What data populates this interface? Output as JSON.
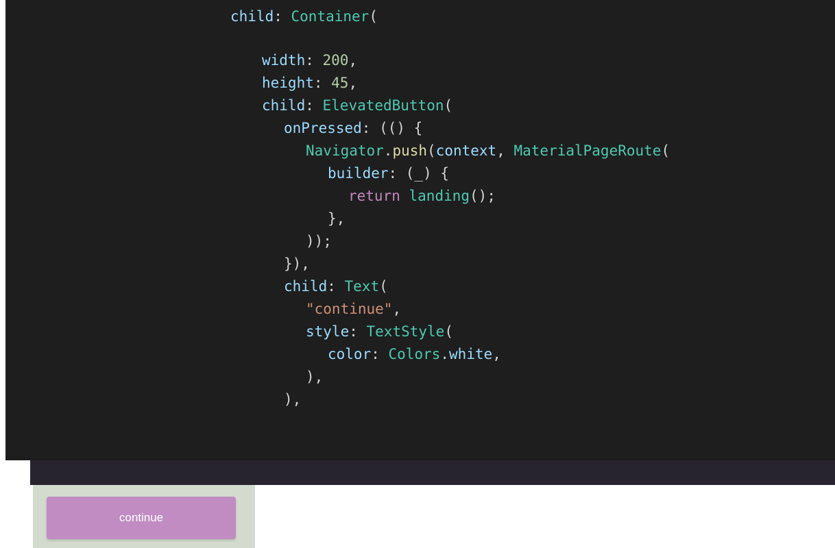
{
  "colors": {
    "code_background": "#1e1e1e",
    "strip_background": "#28242f",
    "preview_background": "#d3dbcf",
    "button_background": "#c08cc2",
    "button_text": "#ffffff",
    "token_property": "#9cdcfe",
    "token_class": "#4ec9b0",
    "token_number": "#b5cea8",
    "token_string": "#ce9178",
    "token_keyword": "#c586c0",
    "token_method": "#dcdcaa",
    "token_punct": "#d4d4d4"
  },
  "code": {
    "lines": [
      {
        "tokens": [
          {
            "t": "child",
            "k": "property"
          },
          {
            "t": ": ",
            "k": "punct"
          },
          {
            "t": "Container",
            "k": "class"
          },
          {
            "t": "(",
            "k": "punct"
          }
        ]
      },
      {
        "tokens": [
          {
            "t": "width",
            "k": "property"
          },
          {
            "t": ": ",
            "k": "punct"
          },
          {
            "t": "200",
            "k": "number"
          },
          {
            "t": ",",
            "k": "punct"
          }
        ]
      },
      {
        "tokens": [
          {
            "t": "height",
            "k": "property"
          },
          {
            "t": ": ",
            "k": "punct"
          },
          {
            "t": "45",
            "k": "number"
          },
          {
            "t": ",",
            "k": "punct"
          }
        ]
      },
      {
        "tokens": [
          {
            "t": "child",
            "k": "property"
          },
          {
            "t": ": ",
            "k": "punct"
          },
          {
            "t": "ElevatedButton",
            "k": "class"
          },
          {
            "t": "(",
            "k": "punct"
          }
        ]
      },
      {
        "tokens": [
          {
            "t": "onPressed",
            "k": "property"
          },
          {
            "t": ": (() {",
            "k": "punct"
          }
        ]
      },
      {
        "tokens": [
          {
            "t": "Navigator",
            "k": "class"
          },
          {
            "t": ".",
            "k": "punct"
          },
          {
            "t": "push",
            "k": "method"
          },
          {
            "t": "(",
            "k": "punct"
          },
          {
            "t": "context",
            "k": "property"
          },
          {
            "t": ", ",
            "k": "punct"
          },
          {
            "t": "MaterialPageRoute",
            "k": "class"
          },
          {
            "t": "(",
            "k": "punct"
          }
        ]
      },
      {
        "tokens": [
          {
            "t": "builder",
            "k": "property"
          },
          {
            "t": ": (_) {",
            "k": "punct"
          }
        ]
      },
      {
        "tokens": [
          {
            "t": "return",
            "k": "keyword"
          },
          {
            "t": " ",
            "k": "punct"
          },
          {
            "t": "landing",
            "k": "class"
          },
          {
            "t": "();",
            "k": "punct"
          }
        ]
      },
      {
        "tokens": [
          {
            "t": "},",
            "k": "punct"
          }
        ]
      },
      {
        "tokens": [
          {
            "t": "));",
            "k": "punct"
          }
        ]
      },
      {
        "tokens": [
          {
            "t": "}),",
            "k": "punct"
          }
        ]
      },
      {
        "tokens": [
          {
            "t": "child",
            "k": "property"
          },
          {
            "t": ": ",
            "k": "punct"
          },
          {
            "t": "Text",
            "k": "class"
          },
          {
            "t": "(",
            "k": "punct"
          }
        ]
      },
      {
        "tokens": [
          {
            "t": "\"continue\"",
            "k": "string"
          },
          {
            "t": ",",
            "k": "punct"
          }
        ]
      },
      {
        "tokens": [
          {
            "t": "style",
            "k": "property"
          },
          {
            "t": ": ",
            "k": "punct"
          },
          {
            "t": "TextStyle",
            "k": "class"
          },
          {
            "t": "(",
            "k": "punct"
          }
        ]
      },
      {
        "tokens": [
          {
            "t": "color",
            "k": "property"
          },
          {
            "t": ": ",
            "k": "punct"
          },
          {
            "t": "Colors",
            "k": "class"
          },
          {
            "t": ".",
            "k": "punct"
          },
          {
            "t": "white",
            "k": "property"
          },
          {
            "t": ",",
            "k": "punct"
          }
        ]
      },
      {
        "tokens": [
          {
            "t": "),",
            "k": "punct"
          }
        ]
      },
      {
        "tokens": [
          {
            "t": "),",
            "k": "punct"
          }
        ]
      }
    ]
  },
  "preview": {
    "button_label": "continue"
  }
}
